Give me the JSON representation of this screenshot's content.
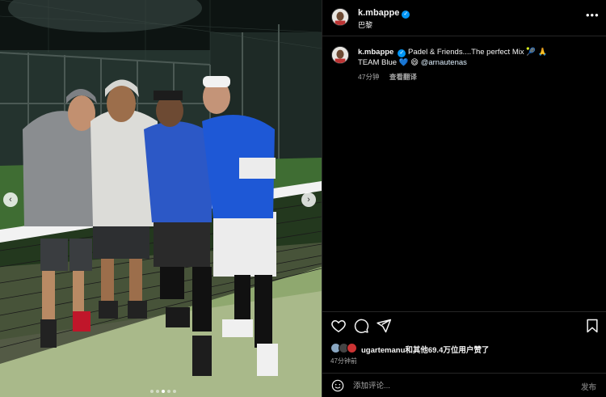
{
  "post": {
    "photo_alt": "Four men posing on a padel court at night",
    "nav_prev_icon": "chevron-left-icon",
    "nav_next_icon": "chevron-right-icon",
    "carousel_count": 5,
    "carousel_active": 3
  },
  "header": {
    "username": "k.mbappe",
    "verified": true,
    "location": "巴黎",
    "more_icon": "more-horizontal-icon"
  },
  "caption": {
    "username": "k.mbappe",
    "text_line1": "Padel & Friends....The perfect Mix 🎾 🙏",
    "text_line2_prefix": "TEAM Blue ",
    "heart": "💙",
    "emoji": "😄",
    "mention": "@arnautenas",
    "time": "47分钟",
    "see_translation": "查看翻译"
  },
  "actions": {
    "like_icon": "heart-icon",
    "comment_icon": "comment-icon",
    "share_icon": "send-icon",
    "save_icon": "bookmark-icon"
  },
  "likes": {
    "text": "ugartemanu和其他69.4万位用户赞了",
    "time": "47分钟前"
  },
  "comment": {
    "placeholder": "添加评论...",
    "post_label": "发布",
    "emoji_icon": "smiley-icon"
  },
  "colors": {
    "background": "#000000",
    "divider": "#262626",
    "verified": "#0095f6",
    "secondary_text": "#a8a8a8"
  }
}
